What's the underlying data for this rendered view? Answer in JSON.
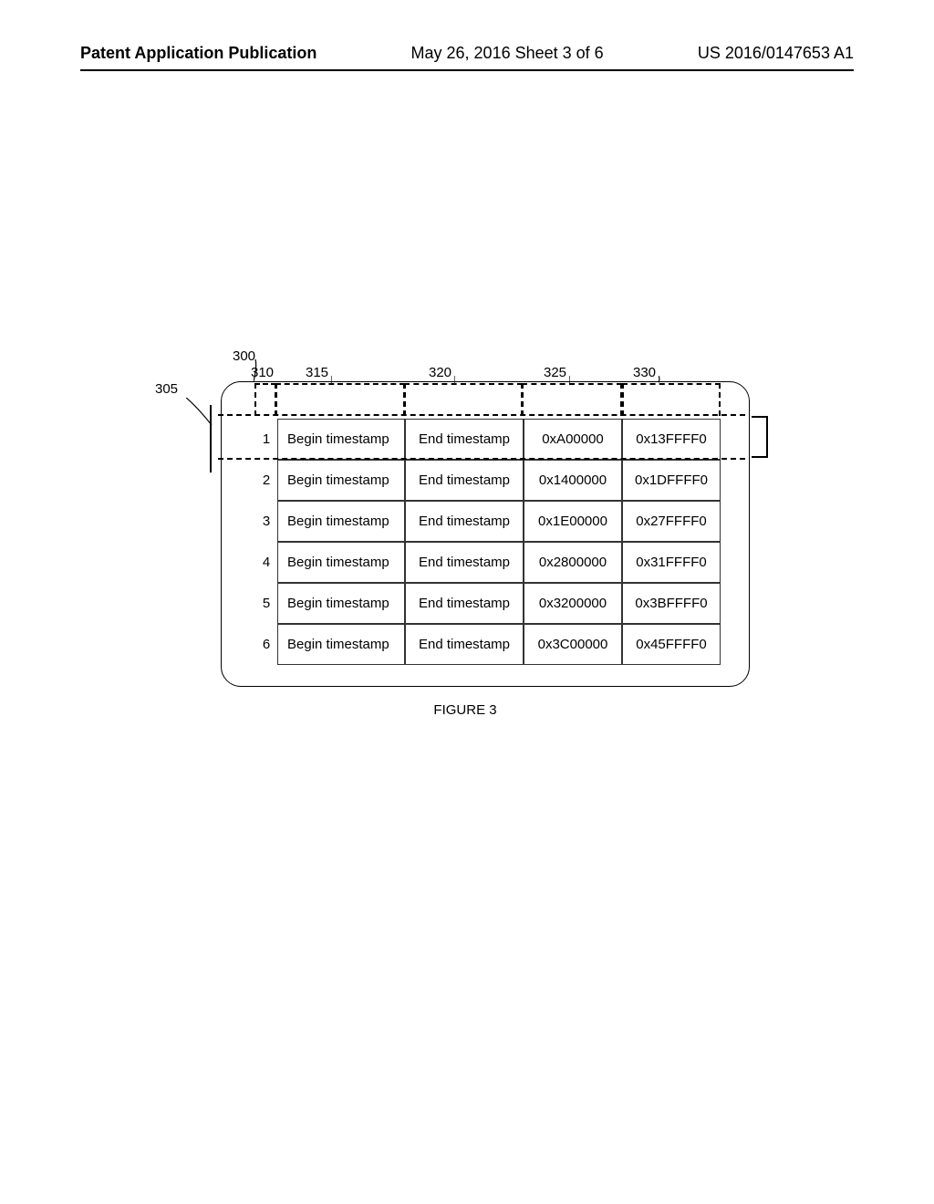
{
  "header": {
    "left": "Patent Application Publication",
    "center": "May 26, 2016  Sheet 3 of 6",
    "right": "US 2016/0147653 A1"
  },
  "figure": {
    "caption": "FIGURE 3",
    "refs": {
      "r300": "300",
      "r305": "305",
      "r310": "310",
      "r315": "315",
      "r320": "320",
      "r325": "325",
      "r330": "330"
    },
    "rows": [
      {
        "idx": "1",
        "begin": "Begin timestamp",
        "end": "End timestamp",
        "startAddr": "0xA00000",
        "endAddr": "0x13FFFF0"
      },
      {
        "idx": "2",
        "begin": "Begin timestamp",
        "end": "End timestamp",
        "startAddr": "0x1400000",
        "endAddr": "0x1DFFFF0"
      },
      {
        "idx": "3",
        "begin": "Begin timestamp",
        "end": "End timestamp",
        "startAddr": "0x1E00000",
        "endAddr": "0x27FFFF0"
      },
      {
        "idx": "4",
        "begin": "Begin timestamp",
        "end": "End timestamp",
        "startAddr": "0x2800000",
        "endAddr": "0x31FFFF0"
      },
      {
        "idx": "5",
        "begin": "Begin timestamp",
        "end": "End timestamp",
        "startAddr": "0x3200000",
        "endAddr": "0x3BFFFF0"
      },
      {
        "idx": "6",
        "begin": "Begin timestamp",
        "end": "End timestamp",
        "startAddr": "0x3C00000",
        "endAddr": "0x45FFFF0"
      }
    ]
  }
}
